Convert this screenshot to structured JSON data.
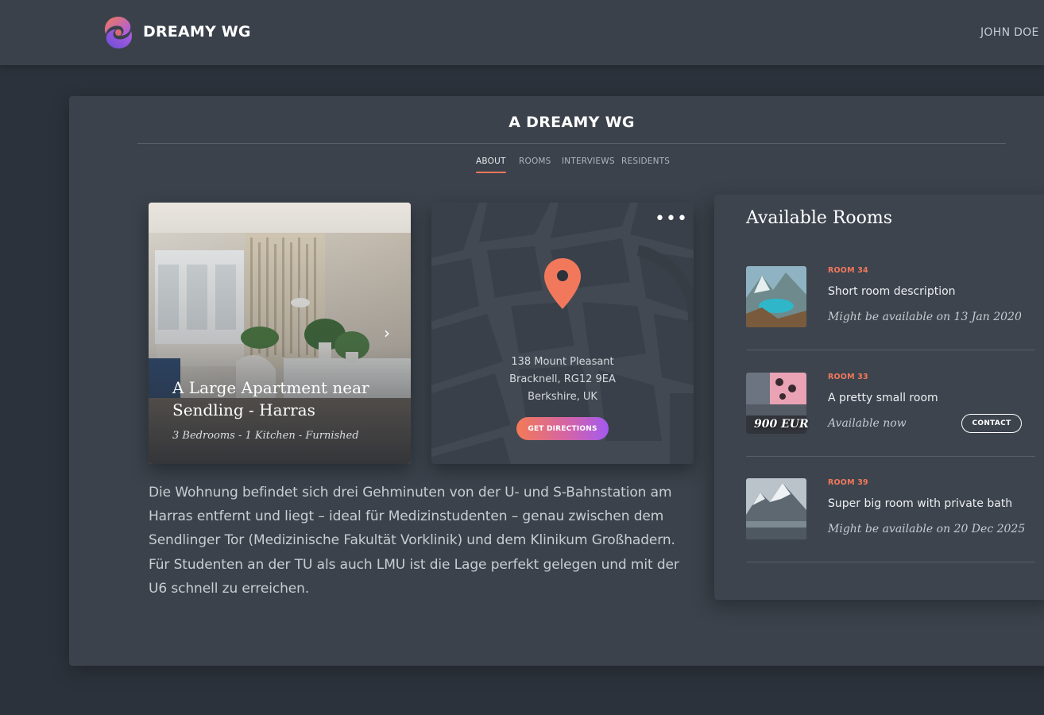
{
  "header": {
    "brand": "DREAMY WG",
    "user": "JOHN DOE"
  },
  "page": {
    "title": "A DREAMY WG",
    "tabs": [
      {
        "label": "ABOUT",
        "active": true
      },
      {
        "label": "ROOMS",
        "active": false
      },
      {
        "label": "INTERVIEWS",
        "active": false
      },
      {
        "label": "RESIDENTS",
        "active": false
      }
    ]
  },
  "apartment": {
    "title": "A Large Apartment near Sendling - Harras",
    "subtitle": "3 Bedrooms - 1 Kitchen - Furnished",
    "next_icon": "chevron-right-icon"
  },
  "location": {
    "address_line1": "138 Mount Pleasant",
    "address_line2": "Bracknell, RG12 9EA",
    "address_line3": "Berkshire, UK",
    "directions_label": "GET DIRECTIONS",
    "more_icon": "more-dots-icon",
    "pin_icon": "map-pin-icon"
  },
  "description": "Die Wohnung befindet sich drei Gehminuten von der U- und S-Bahnstation am Harras entfernt und liegt – ideal für Medizinstudenten – genau zwischen dem Sendlinger Tor (Medizinische Fakultät Vorklinik) und dem Klinikum Großhadern. Für Studenten an der TU als auch LMU ist die Lage perfekt gelegen und mit der U6 schnell zu erreichen.",
  "rooms": {
    "title": "Available Rooms",
    "items": [
      {
        "number": "ROOM 34",
        "description": "Short room description",
        "availability": "Might be available on 13 Jan 2020"
      },
      {
        "number": "ROOM 33",
        "description": "A pretty small room",
        "availability": "Available now",
        "price": "900 EUR",
        "contact_label": "CONTACT"
      },
      {
        "number": "ROOM 39",
        "description": "Super big room with private bath",
        "availability": "Might be available on 20 Dec 2025"
      }
    ]
  },
  "colors": {
    "accent": "#f2785c",
    "gradient_end": "#a35af0",
    "background": "#2c323b",
    "panel": "#3b424b"
  }
}
